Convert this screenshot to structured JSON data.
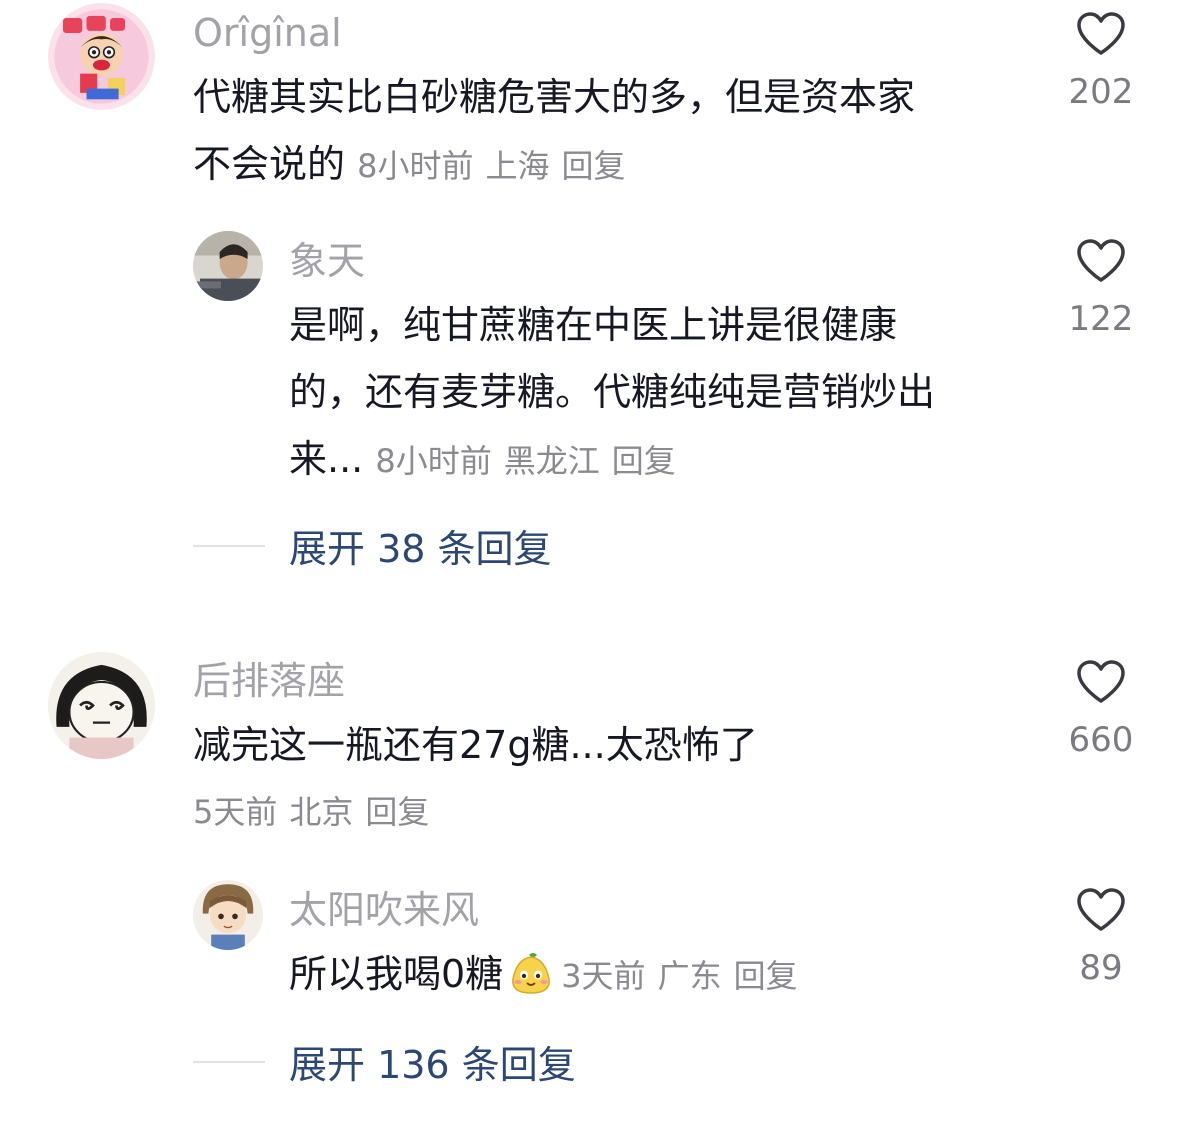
{
  "comments": [
    {
      "username": "Orîgînal",
      "text_line1": "代糖其实比白砂糖危害大的多，但是资本家",
      "text_line2": "不会说的",
      "time": "8小时前",
      "location": "上海",
      "reply": "回复",
      "likes": "202",
      "avatar": "cartoon-boy-avatar",
      "replies": [
        {
          "username": "象天",
          "text_line1": "是啊，纯甘蔗糖在中医上讲是很健康",
          "text_line2": "的，还有麦芽糖。代糖纯纯是营销炒出",
          "text_line3": "来...",
          "time": "8小时前",
          "location": "黑龙江",
          "reply": "回复",
          "likes": "122",
          "avatar": "man-photo-avatar"
        }
      ],
      "expand_label": "展开 38 条回复"
    },
    {
      "username": "后排落座",
      "text_line1": "减完这一瓶还有27g糖...太恐怖了",
      "time": "5天前",
      "location": "北京",
      "reply": "回复",
      "likes": "660",
      "avatar": "sketch-face-avatar",
      "replies": [
        {
          "username": "太阳吹来风",
          "text_line1": "所以我喝0糖",
          "emoji": "smiling-pear-emoji",
          "time": "3天前",
          "location": "广东",
          "reply": "回复",
          "likes": "89",
          "avatar": "anime-girl-avatar"
        }
      ],
      "expand_label": "展开 136 条回复"
    }
  ],
  "colors": {
    "username": "#a2a2a8",
    "text": "#161823",
    "meta": "#8a8a90",
    "expand": "#2b4874"
  }
}
